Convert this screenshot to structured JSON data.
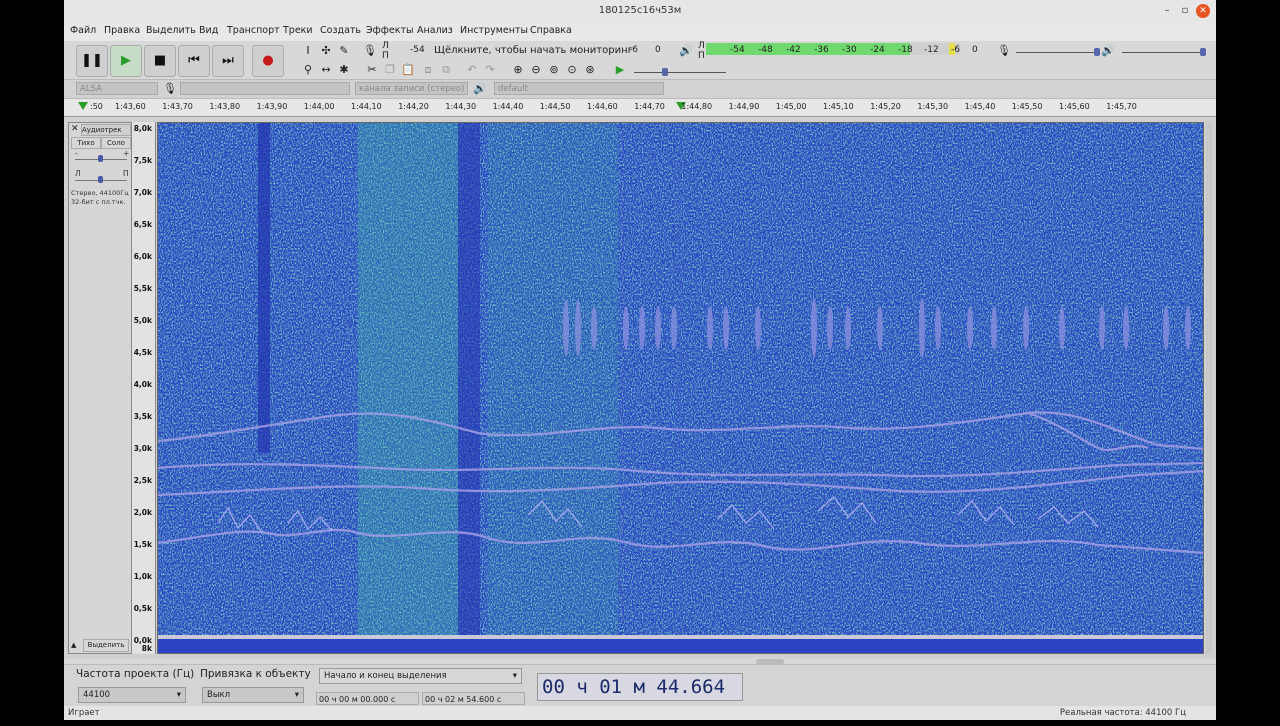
{
  "window": {
    "title": "180125c16ч53м"
  },
  "menu": [
    "Файл",
    "Правка",
    "Выделить",
    "Вид",
    "Транспорт",
    "Треки",
    "Создать",
    "Эффекты",
    "Анализ",
    "Инструменты",
    "Справка"
  ],
  "meters": {
    "record_prompt": "Щёлкните, чтобы начать мониторинг",
    "record_lr": [
      "Л",
      "П"
    ],
    "play_lr": [
      "Л",
      "П"
    ],
    "record_scale": [
      "-54",
      "-6",
      "0"
    ],
    "play_scale": [
      "-54",
      "-48",
      "-42",
      "-36",
      "-30",
      "-24",
      "-18",
      "-12",
      "-6",
      "0"
    ]
  },
  "device": {
    "host": "ALSA",
    "input_channels": "канала записи (стерео)",
    "output": "default"
  },
  "ruler": {
    "ticks": [
      ":50",
      "1:43,60",
      "1:43,70",
      "1:43,80",
      "1:43,90",
      "1:44,00",
      "1:44,10",
      "1:44,20",
      "1:44,30",
      "1:44,40",
      "1:44,50",
      "1:44,60",
      "1:44,70",
      "1:44,80",
      "1:44,90",
      "1:45,00",
      "1:45,10",
      "1:45,20",
      "1:45,30",
      "1:45,40",
      "1:45,50",
      "1:45,60",
      "1:45,70"
    ]
  },
  "track": {
    "name": "Аудиотрек",
    "mute": "Тихо",
    "solo": "Соло",
    "gain_minus": "-",
    "gain_plus": "+",
    "pan_left": "Л",
    "pan_right": "П",
    "info1": "Стерео, 44100Гц",
    "info2": "32-бит с пл.тчк.",
    "select": "Выделить",
    "freq_labels": [
      "8,0k",
      "7,5k",
      "7,0k",
      "6,5k",
      "6,0k",
      "5,5k",
      "5,0k",
      "4,5k",
      "4,0k",
      "3,5k",
      "3,0k",
      "2,5k",
      "2,0k",
      "1,5k",
      "1,0k",
      "0,5k",
      "0,0k",
      "8k"
    ]
  },
  "selection": {
    "rate_label": "Частота проекта (Гц)",
    "snap_label": "Привязка к объекту",
    "rate_value": "44100",
    "snap_value": "Выкл",
    "mode": "Начало и конец выделения",
    "start": "00 ч 00 м 00.000 с",
    "end": "00 ч 02 м 54.600 с",
    "position": "00 ч 01 м 44.664 с"
  },
  "status": {
    "left": "Играет",
    "right": "Реальная частота: 44100 Гц"
  },
  "colors": {
    "spectrogram_bg": "#2a3fc4",
    "spectrogram_hi": "#35b8a2",
    "meter_green": "#6fd86f",
    "meter_yellow": "#e6e04a",
    "play_green": "#2a9d2a",
    "record_red": "#c41a1a"
  }
}
